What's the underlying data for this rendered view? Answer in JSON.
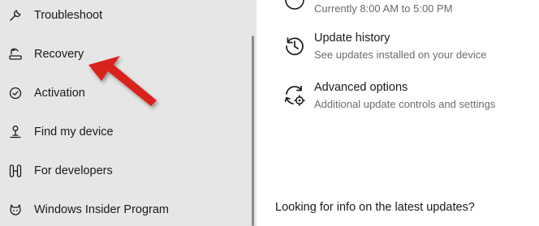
{
  "sidebar": {
    "items": [
      {
        "label": "Troubleshoot",
        "icon": "wrench-icon"
      },
      {
        "label": "Recovery",
        "icon": "recovery-icon"
      },
      {
        "label": "Activation",
        "icon": "check-circle-icon"
      },
      {
        "label": "Find my device",
        "icon": "person-location-icon"
      },
      {
        "label": "For developers",
        "icon": "developer-tools-icon"
      },
      {
        "label": "Windows Insider Program",
        "icon": "insider-cat-icon"
      }
    ]
  },
  "main": {
    "active_hours_subtitle": "Currently 8:00 AM to 5:00 PM",
    "update_history": {
      "title": "Update history",
      "subtitle": "See updates installed on your device",
      "icon": "history-icon"
    },
    "advanced_options": {
      "title": "Advanced options",
      "subtitle": "Additional update controls and settings",
      "icon": "gear-sync-icon"
    },
    "info_heading": "Looking for info on the latest updates?"
  },
  "annotation": {
    "arrow_color": "#d9201f",
    "points_to": "Recovery"
  },
  "colors": {
    "sidebar_bg": "#e6e6e6",
    "content_bg": "#ffffff",
    "secondary_text": "#6b6b6b"
  }
}
